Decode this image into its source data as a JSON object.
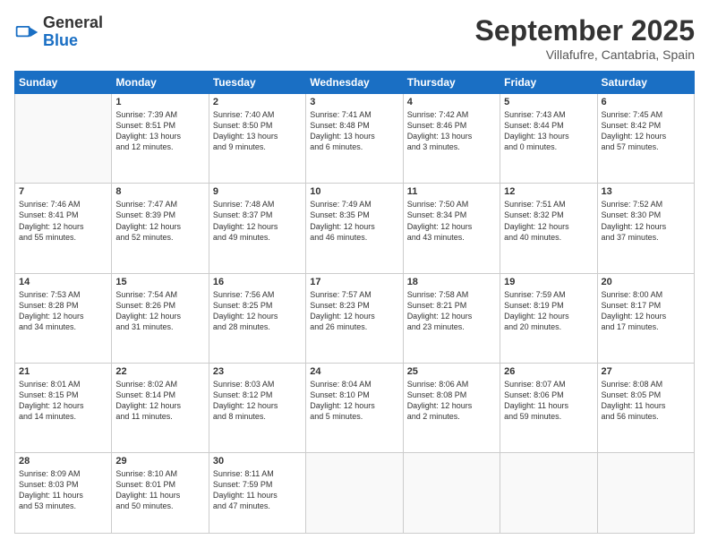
{
  "header": {
    "logo_general": "General",
    "logo_blue": "Blue",
    "month_title": "September 2025",
    "location": "Villafufre, Cantabria, Spain"
  },
  "weekdays": [
    "Sunday",
    "Monday",
    "Tuesday",
    "Wednesday",
    "Thursday",
    "Friday",
    "Saturday"
  ],
  "weeks": [
    [
      {
        "day": "",
        "info": ""
      },
      {
        "day": "1",
        "info": "Sunrise: 7:39 AM\nSunset: 8:51 PM\nDaylight: 13 hours\nand 12 minutes."
      },
      {
        "day": "2",
        "info": "Sunrise: 7:40 AM\nSunset: 8:50 PM\nDaylight: 13 hours\nand 9 minutes."
      },
      {
        "day": "3",
        "info": "Sunrise: 7:41 AM\nSunset: 8:48 PM\nDaylight: 13 hours\nand 6 minutes."
      },
      {
        "day": "4",
        "info": "Sunrise: 7:42 AM\nSunset: 8:46 PM\nDaylight: 13 hours\nand 3 minutes."
      },
      {
        "day": "5",
        "info": "Sunrise: 7:43 AM\nSunset: 8:44 PM\nDaylight: 13 hours\nand 0 minutes."
      },
      {
        "day": "6",
        "info": "Sunrise: 7:45 AM\nSunset: 8:42 PM\nDaylight: 12 hours\nand 57 minutes."
      }
    ],
    [
      {
        "day": "7",
        "info": "Sunrise: 7:46 AM\nSunset: 8:41 PM\nDaylight: 12 hours\nand 55 minutes."
      },
      {
        "day": "8",
        "info": "Sunrise: 7:47 AM\nSunset: 8:39 PM\nDaylight: 12 hours\nand 52 minutes."
      },
      {
        "day": "9",
        "info": "Sunrise: 7:48 AM\nSunset: 8:37 PM\nDaylight: 12 hours\nand 49 minutes."
      },
      {
        "day": "10",
        "info": "Sunrise: 7:49 AM\nSunset: 8:35 PM\nDaylight: 12 hours\nand 46 minutes."
      },
      {
        "day": "11",
        "info": "Sunrise: 7:50 AM\nSunset: 8:34 PM\nDaylight: 12 hours\nand 43 minutes."
      },
      {
        "day": "12",
        "info": "Sunrise: 7:51 AM\nSunset: 8:32 PM\nDaylight: 12 hours\nand 40 minutes."
      },
      {
        "day": "13",
        "info": "Sunrise: 7:52 AM\nSunset: 8:30 PM\nDaylight: 12 hours\nand 37 minutes."
      }
    ],
    [
      {
        "day": "14",
        "info": "Sunrise: 7:53 AM\nSunset: 8:28 PM\nDaylight: 12 hours\nand 34 minutes."
      },
      {
        "day": "15",
        "info": "Sunrise: 7:54 AM\nSunset: 8:26 PM\nDaylight: 12 hours\nand 31 minutes."
      },
      {
        "day": "16",
        "info": "Sunrise: 7:56 AM\nSunset: 8:25 PM\nDaylight: 12 hours\nand 28 minutes."
      },
      {
        "day": "17",
        "info": "Sunrise: 7:57 AM\nSunset: 8:23 PM\nDaylight: 12 hours\nand 26 minutes."
      },
      {
        "day": "18",
        "info": "Sunrise: 7:58 AM\nSunset: 8:21 PM\nDaylight: 12 hours\nand 23 minutes."
      },
      {
        "day": "19",
        "info": "Sunrise: 7:59 AM\nSunset: 8:19 PM\nDaylight: 12 hours\nand 20 minutes."
      },
      {
        "day": "20",
        "info": "Sunrise: 8:00 AM\nSunset: 8:17 PM\nDaylight: 12 hours\nand 17 minutes."
      }
    ],
    [
      {
        "day": "21",
        "info": "Sunrise: 8:01 AM\nSunset: 8:15 PM\nDaylight: 12 hours\nand 14 minutes."
      },
      {
        "day": "22",
        "info": "Sunrise: 8:02 AM\nSunset: 8:14 PM\nDaylight: 12 hours\nand 11 minutes."
      },
      {
        "day": "23",
        "info": "Sunrise: 8:03 AM\nSunset: 8:12 PM\nDaylight: 12 hours\nand 8 minutes."
      },
      {
        "day": "24",
        "info": "Sunrise: 8:04 AM\nSunset: 8:10 PM\nDaylight: 12 hours\nand 5 minutes."
      },
      {
        "day": "25",
        "info": "Sunrise: 8:06 AM\nSunset: 8:08 PM\nDaylight: 12 hours\nand 2 minutes."
      },
      {
        "day": "26",
        "info": "Sunrise: 8:07 AM\nSunset: 8:06 PM\nDaylight: 11 hours\nand 59 minutes."
      },
      {
        "day": "27",
        "info": "Sunrise: 8:08 AM\nSunset: 8:05 PM\nDaylight: 11 hours\nand 56 minutes."
      }
    ],
    [
      {
        "day": "28",
        "info": "Sunrise: 8:09 AM\nSunset: 8:03 PM\nDaylight: 11 hours\nand 53 minutes."
      },
      {
        "day": "29",
        "info": "Sunrise: 8:10 AM\nSunset: 8:01 PM\nDaylight: 11 hours\nand 50 minutes."
      },
      {
        "day": "30",
        "info": "Sunrise: 8:11 AM\nSunset: 7:59 PM\nDaylight: 11 hours\nand 47 minutes."
      },
      {
        "day": "",
        "info": ""
      },
      {
        "day": "",
        "info": ""
      },
      {
        "day": "",
        "info": ""
      },
      {
        "day": "",
        "info": ""
      }
    ]
  ]
}
